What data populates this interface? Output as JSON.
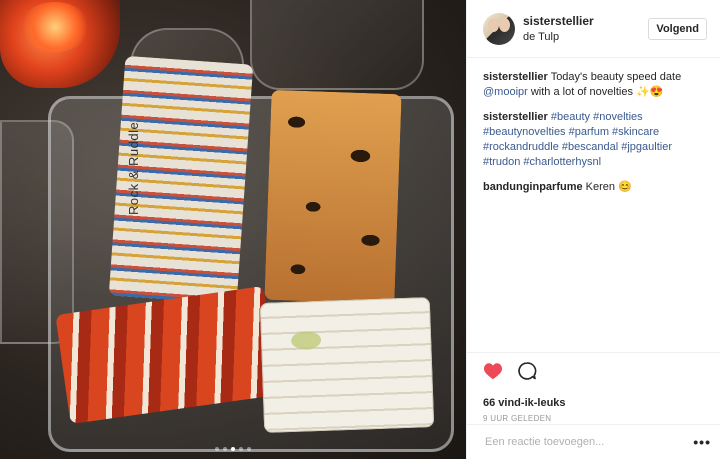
{
  "post": {
    "username": "sisterstellier",
    "location": "de Tulp",
    "follow_label": "Volgend"
  },
  "comments": [
    {
      "user": "sisterstellier",
      "parts": [
        {
          "text": "Today's beauty speed date ",
          "link": false
        },
        {
          "text": "@mooipr",
          "link": true
        },
        {
          "text": " with a lot of novelties ✨😍",
          "link": false
        }
      ]
    },
    {
      "user": "sisterstellier",
      "parts": [
        {
          "text": "#beauty",
          "link": true
        },
        {
          "text": " ",
          "link": false
        },
        {
          "text": "#novelties",
          "link": true
        },
        {
          "text": " ",
          "link": false
        },
        {
          "text": "#beautynovelties",
          "link": true
        },
        {
          "text": " ",
          "link": false
        },
        {
          "text": "#parfum",
          "link": true
        },
        {
          "text": " ",
          "link": false
        },
        {
          "text": "#skincare",
          "link": true
        },
        {
          "text": " ",
          "link": false
        },
        {
          "text": "#rockandruddle",
          "link": true
        },
        {
          "text": " ",
          "link": false
        },
        {
          "text": "#bescandal",
          "link": true
        },
        {
          "text": " ",
          "link": false
        },
        {
          "text": "#jpgaultier",
          "link": true
        },
        {
          "text": " ",
          "link": false
        },
        {
          "text": "#trudon",
          "link": true
        },
        {
          "text": " ",
          "link": false
        },
        {
          "text": "#charlotterhysnl",
          "link": true
        }
      ]
    },
    {
      "user": "bandunginparfume",
      "parts": [
        {
          "text": "Keren 😊",
          "link": false
        }
      ]
    }
  ],
  "photo": {
    "comb_label": "Rock & Ruddle",
    "carousel": {
      "count": 5,
      "active": 2
    }
  },
  "actions": {
    "likes": "66 vind-ik-leuks",
    "time": "9 UUR GELEDEN",
    "liked": true,
    "like_color": "#ed4956"
  },
  "add_comment": {
    "placeholder": "Een reactie toevoegen...",
    "more_label": "•••"
  }
}
